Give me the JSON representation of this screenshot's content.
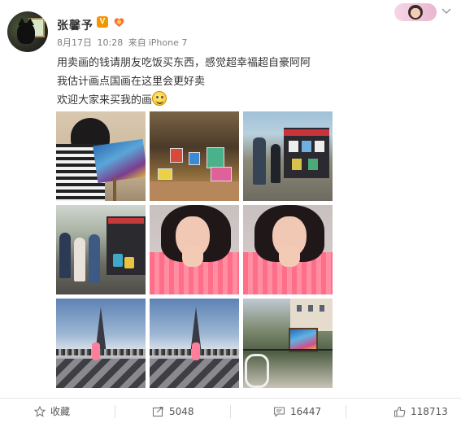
{
  "user": {
    "name": "张馨予",
    "verified_badge": "V",
    "colors": {
      "verified": "#f39700",
      "link": "#5b7fb4"
    }
  },
  "post": {
    "date": "8月17日",
    "time": "10:28",
    "source_prefix": "来自",
    "source": "iPhone 7",
    "lines": [
      "用卖画的钱请朋友吃饭买东西，感觉超幸福超自豪阿阿",
      "我估计画点国画在这里会更好卖",
      "欢迎大家来买我的画"
    ],
    "emoji": "smile-emoji",
    "photo_count": 9
  },
  "actions": {
    "favorite": {
      "label": "收藏",
      "icon": "star-icon"
    },
    "repost": {
      "count": "5048",
      "icon": "repost-icon"
    },
    "comment": {
      "count": "16447",
      "icon": "comment-icon"
    },
    "like": {
      "count": "118713",
      "icon": "thumbs-up-icon"
    }
  }
}
